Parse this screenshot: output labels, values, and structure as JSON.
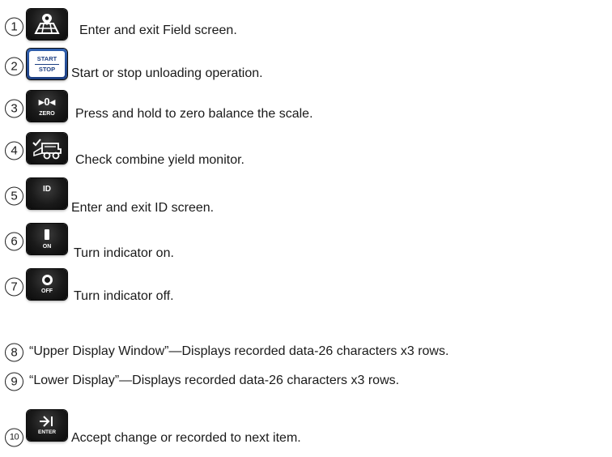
{
  "items": [
    {
      "number": "1",
      "icon": "field-map-icon",
      "text": "Enter and exit Field screen."
    },
    {
      "number": "2",
      "icon": "start-stop-icon",
      "key_top": "START",
      "key_bottom": "STOP",
      "text": "Start or stop unloading operation."
    },
    {
      "number": "3",
      "icon": "zero-balance-icon",
      "key_top": "▸0◂",
      "key_bottom": "ZERO",
      "text": "Press and hold to zero balance the scale."
    },
    {
      "number": "4",
      "icon": "combine-check-icon",
      "text": "Check combine yield monitor."
    },
    {
      "number": "5",
      "icon": "id-icon",
      "key_label": "ID",
      "text": "Enter and exit ID screen."
    },
    {
      "number": "6",
      "icon": "power-on-icon",
      "key_label": "ON",
      "text": "Turn indicator on."
    },
    {
      "number": "7",
      "icon": "power-off-icon",
      "key_label": "OFF",
      "text": "Turn indicator off."
    },
    {
      "number": "8",
      "text": "“Upper Display Window”—Displays recorded data-26 characters x3 rows."
    },
    {
      "number": "9",
      "text": "“Lower Display”—Displays recorded data-26 characters x3 rows."
    },
    {
      "number": "10",
      "icon": "enter-icon",
      "key_label": "ENTER",
      "text": "Accept change or recorded to next item."
    }
  ]
}
